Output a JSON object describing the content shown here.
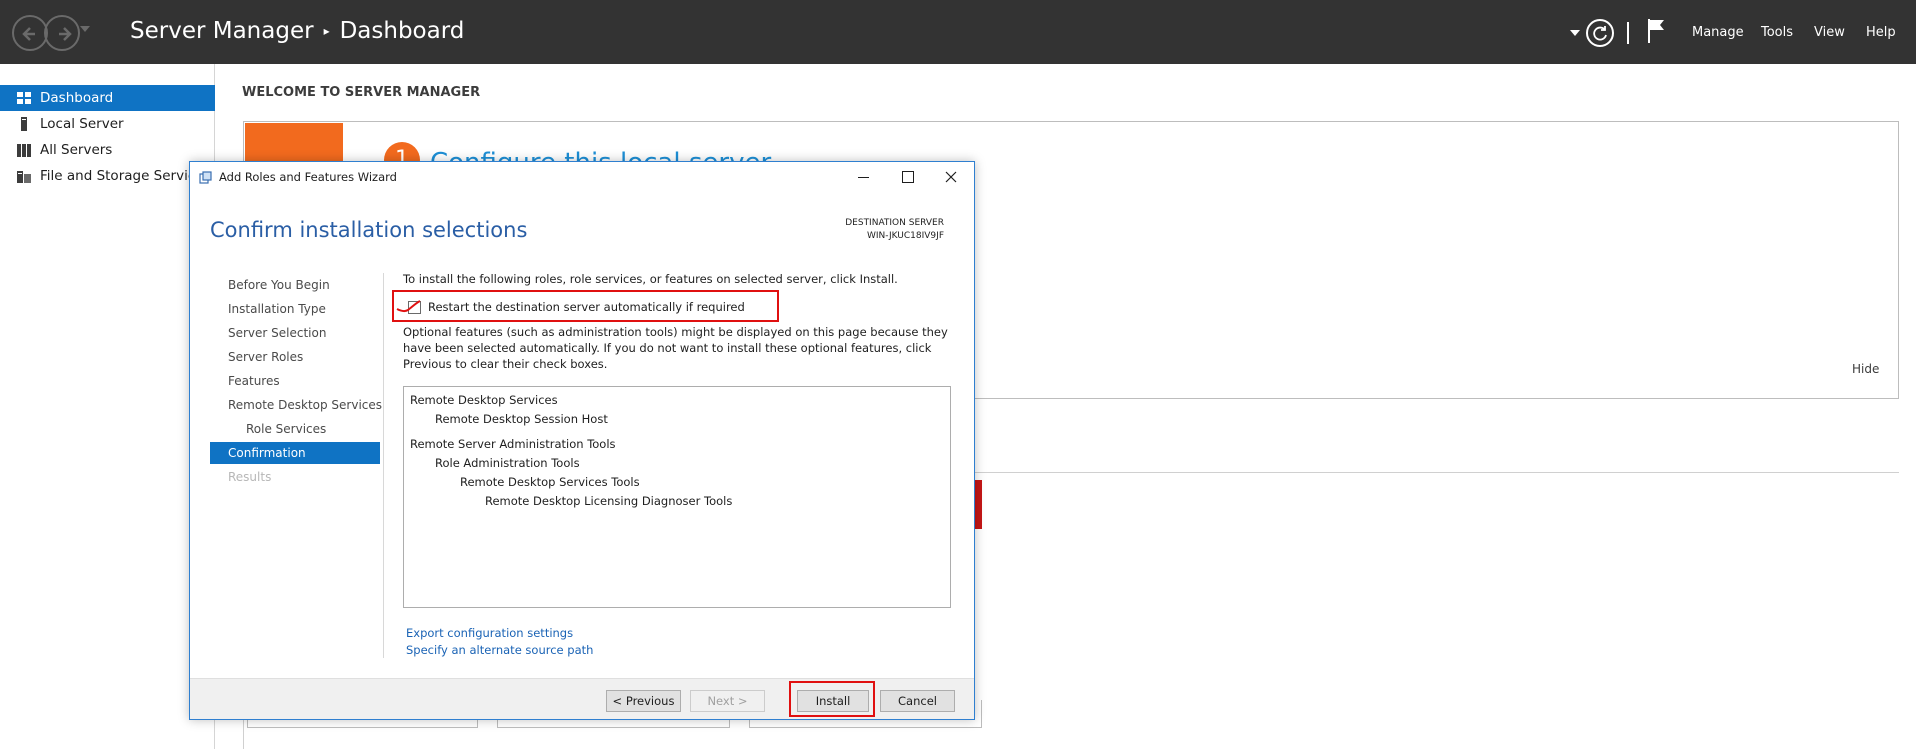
{
  "topbar": {
    "title_app": "Server Manager",
    "title_separator": "▸",
    "title_page": "Dashboard",
    "menu": [
      "Manage",
      "Tools",
      "View",
      "Help"
    ]
  },
  "sidebar": {
    "items": [
      {
        "label": "Dashboard",
        "icon": "dashboard-icon",
        "selected": true
      },
      {
        "label": "Local Server",
        "icon": "server-icon"
      },
      {
        "label": "All Servers",
        "icon": "servers-icon"
      },
      {
        "label": "File and Storage Services",
        "icon": "storage-icon"
      }
    ]
  },
  "main": {
    "welcome_title": "WELCOME TO SERVER MANAGER",
    "step_number": "1",
    "step_title": "Configure this local server",
    "hide_label": "Hide"
  },
  "wizard": {
    "window_title": "Add Roles and Features Wizard",
    "heading": "Confirm installation selections",
    "destination_label": "DESTINATION SERVER",
    "destination_value": "WIN-JKUC18IV9JF",
    "nav_steps": [
      {
        "label": "Before You Begin",
        "state": "normal"
      },
      {
        "label": "Installation Type",
        "state": "normal"
      },
      {
        "label": "Server Selection",
        "state": "normal"
      },
      {
        "label": "Server Roles",
        "state": "normal"
      },
      {
        "label": "Features",
        "state": "normal"
      },
      {
        "label": "Remote Desktop Services",
        "state": "normal"
      },
      {
        "label": "Role Services",
        "state": "normal"
      },
      {
        "label": "Confirmation",
        "state": "active"
      },
      {
        "label": "Results",
        "state": "disabled"
      }
    ],
    "intro_text": "To install the following roles, role services, or features on selected server, click Install.",
    "restart_label": "Restart the destination server automatically if required",
    "restart_checked": false,
    "optional_text": "Optional features (such as administration tools) might be displayed on this page because they have been selected automatically. If you do not want to install these optional features, click Previous to clear their check boxes.",
    "selections": [
      {
        "label": "Remote Desktop Services",
        "level": 0
      },
      {
        "label": "Remote Desktop Session Host",
        "level": 1
      },
      {
        "label": "Remote Server Administration Tools",
        "level": 0
      },
      {
        "label": "Role Administration Tools",
        "level": 1
      },
      {
        "label": "Remote Desktop Services Tools",
        "level": 2
      },
      {
        "label": "Remote Desktop Licensing Diagnoser Tools",
        "level": 3
      }
    ],
    "link_export": "Export configuration settings",
    "link_alternate": "Specify an alternate source path",
    "buttons": {
      "previous": "< Previous",
      "next": "Next >",
      "install": "Install",
      "cancel": "Cancel"
    }
  },
  "colors": {
    "accent": "#0f73c4",
    "topbar": "#333333",
    "orange": "#f26a1e",
    "highlight_red": "#e01010",
    "heading_blue": "#2a5ea5"
  }
}
